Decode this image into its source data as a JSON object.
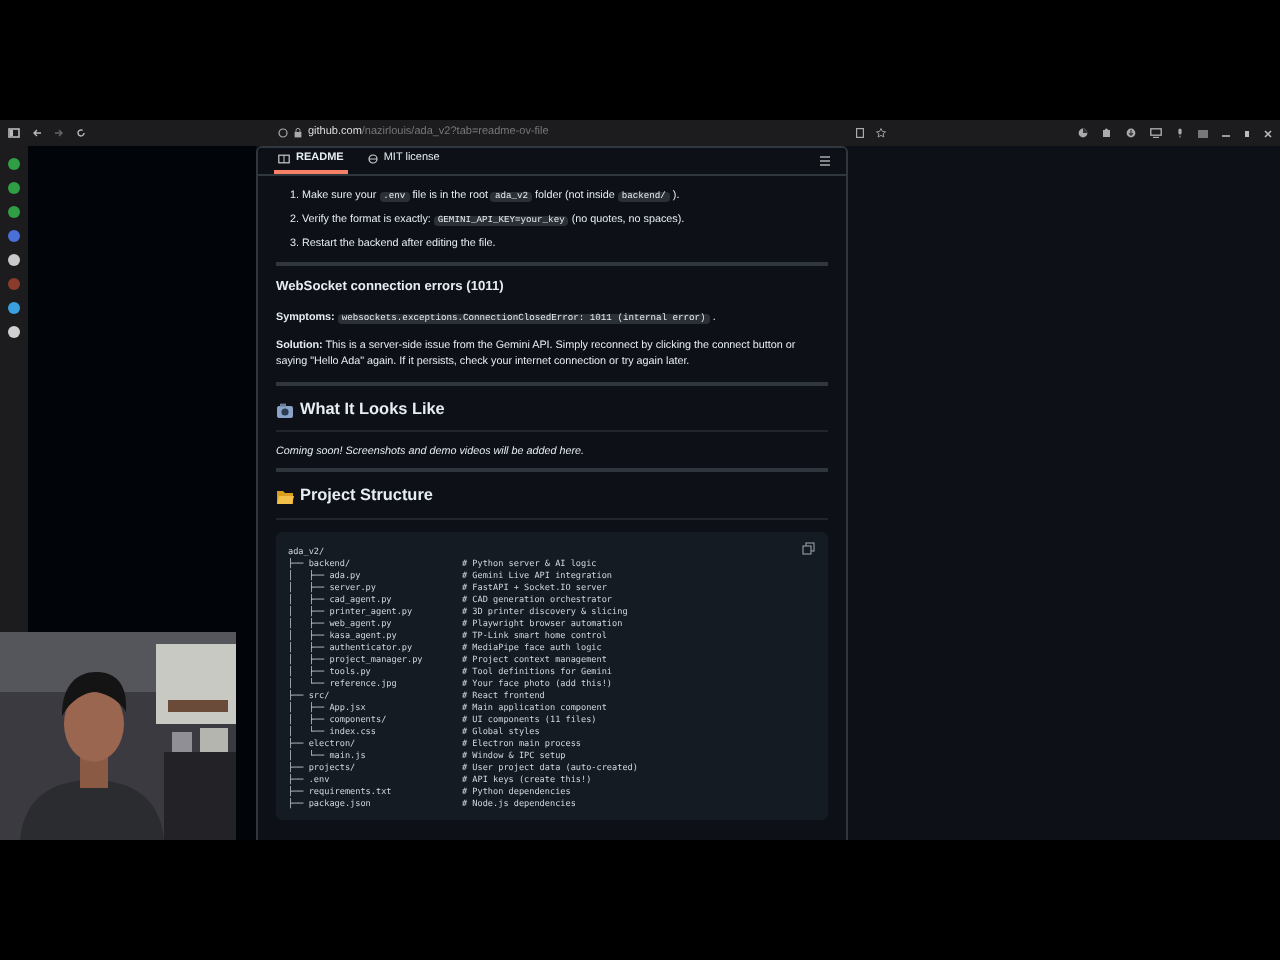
{
  "browser": {
    "url_host": "github.com",
    "url_path": "/nazirlouis/ada_v2?tab=readme-ov-file"
  },
  "sidebar": {
    "icons": [
      {
        "color": "#2ea043"
      },
      {
        "color": "#2ea043"
      },
      {
        "color": "#2ea043"
      },
      {
        "color": "#4a6fd8"
      },
      {
        "color": "#c9c9c9"
      },
      {
        "color": "#8a3b2c"
      },
      {
        "color": "#3aa0e0"
      },
      {
        "color": "#d0d0d0"
      }
    ]
  },
  "tabs": [
    {
      "label": "README",
      "selected": true
    },
    {
      "label": "MIT license",
      "selected": false
    }
  ],
  "readme": {
    "blocks": [
      {
        "kind": "ordered",
        "items": [
          {
            "number": "1.",
            "parts": [
              {
                "kind": "plain",
                "text": "Make sure your"
              },
              {
                "kind": "code",
                "text": ".env"
              },
              {
                "kind": "plain",
                "text": "file is in the root"
              },
              {
                "kind": "code",
                "text": "ada_v2"
              },
              {
                "kind": "plain",
                "text": "folder (not inside"
              },
              {
                "kind": "code",
                "text": "backend/"
              },
              {
                "kind": "plain",
                "text": ")."
              }
            ]
          },
          {
            "number": "2.",
            "parts": [
              {
                "kind": "plain",
                "text": "Verify the format is exactly:"
              },
              {
                "kind": "code",
                "text": "GEMINI_API_KEY=your_key"
              },
              {
                "kind": "plain",
                "text": "(no quotes, no spaces)."
              }
            ]
          },
          {
            "number": "3.",
            "parts": [
              {
                "kind": "plain",
                "text": "Restart the backend after editing the file."
              }
            ]
          }
        ]
      },
      {
        "kind": "rule"
      },
      {
        "kind": "h3",
        "text": "WebSocket connection errors (1011)"
      },
      {
        "kind": "para",
        "parts": [
          {
            "kind": "bold",
            "text": "Symptoms:"
          },
          {
            "kind": "code",
            "text": "websockets.exceptions.ConnectionClosedError: 1011 (internal error)"
          },
          {
            "kind": "plain",
            "text": "."
          }
        ]
      },
      {
        "kind": "rich",
        "text": "**Solution:** This is a server-side issue from the Gemini API. Simply reconnect by clicking the connect button or saying \"Hello Ada\" again. If it persists, check your internet connection or try again later."
      },
      {
        "kind": "rule"
      },
      {
        "kind": "h2",
        "text": "What It Looks Like"
      },
      {
        "kind": "italic",
        "text": "Coming soon! Screenshots and demo videos will be added here."
      },
      {
        "kind": "rule"
      },
      {
        "kind": "h2",
        "text": "Project Structure"
      },
      {
        "kind": "code",
        "lines": [
          {
            "tree": "ada_v2/"
          },
          {
            "tree": "├── backend/",
            "comment": "# Python server & AI logic"
          },
          {
            "tree": "│   ├── ada.py",
            "comment": "# Gemini Live API integration"
          },
          {
            "tree": "│   ├── server.py",
            "comment": "# FastAPI + Socket.IO server"
          },
          {
            "tree": "│   ├── cad_agent.py",
            "comment": "# CAD generation orchestrator"
          },
          {
            "tree": "│   ├── printer_agent.py",
            "comment": "# 3D printer discovery & slicing"
          },
          {
            "tree": "│   ├── web_agent.py",
            "comment": "# Playwright browser automation"
          },
          {
            "tree": "│   ├── kasa_agent.py",
            "comment": "# TP-Link smart home control"
          },
          {
            "tree": "│   ├── authenticator.py",
            "comment": "# MediaPipe face auth logic"
          },
          {
            "tree": "│   ├── project_manager.py",
            "comment": "# Project context management"
          },
          {
            "tree": "│   ├── tools.py",
            "comment": "# Tool definitions for Gemini"
          },
          {
            "tree": "│   └── reference.jpg",
            "comment": "# Your face photo (add this!)"
          },
          {
            "tree": "├── src/",
            "comment": "# React frontend"
          },
          {
            "tree": "│   ├── App.jsx",
            "comment": "# Main application component"
          },
          {
            "tree": "│   ├── components/",
            "comment": "# UI components (11 files)"
          },
          {
            "tree": "│   └── index.css",
            "comment": "# Global styles"
          },
          {
            "tree": "├── electron/",
            "comment": "# Electron main process"
          },
          {
            "tree": "│   └── main.js",
            "comment": "# Window & IPC setup"
          },
          {
            "tree": "├── projects/",
            "comment": "# User project data (auto-created)"
          },
          {
            "tree": "├── .env",
            "comment": "# API keys (create this!)"
          },
          {
            "tree": "├── requirements.txt",
            "comment": "# Python dependencies"
          },
          {
            "tree": "├── package.json",
            "comment": "# Node.js dependencies"
          }
        ]
      }
    ]
  }
}
